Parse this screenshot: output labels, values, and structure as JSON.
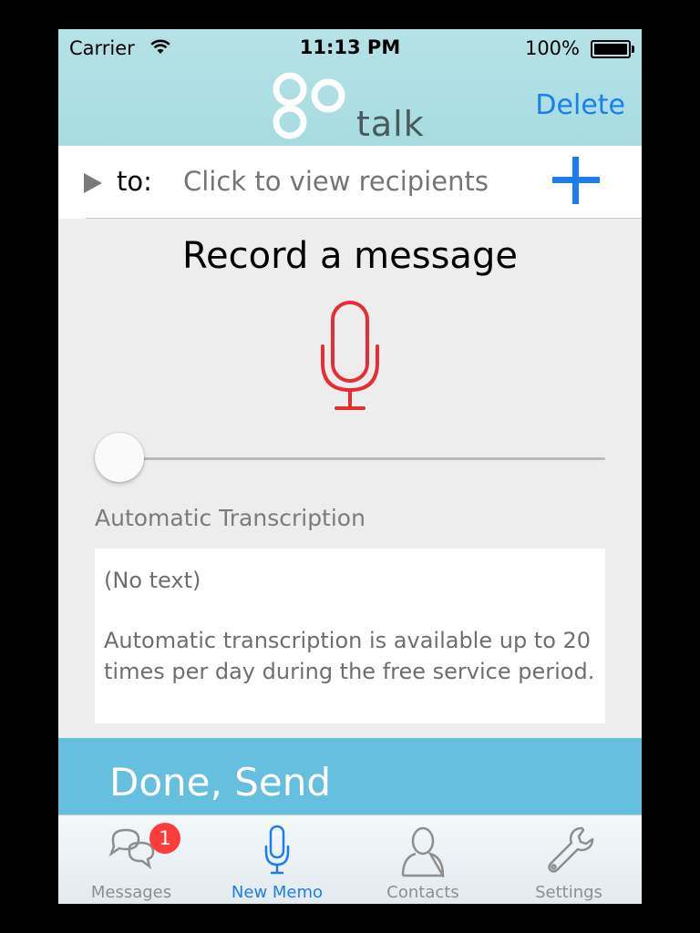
{
  "status_bar": {
    "carrier": "Carrier",
    "time": "11:13 PM",
    "battery": "100%"
  },
  "header": {
    "logo_text": "talk",
    "delete_label": "Delete"
  },
  "recipients": {
    "to_label": "to:",
    "placeholder": "Click to view recipients"
  },
  "recorder": {
    "title": "Record a message",
    "progress": 0
  },
  "transcription": {
    "label": "Automatic Transcription",
    "text_status": "(No text)",
    "info": "Automatic transcription is available up to 20 times per day during the free service period."
  },
  "done_button": {
    "label": "Done, Send"
  },
  "tabs": [
    {
      "label": "Messages",
      "icon": "chat-bubbles-icon",
      "badge": "1"
    },
    {
      "label": "New Memo",
      "icon": "microphone-icon",
      "active": true
    },
    {
      "label": "Contacts",
      "icon": "person-icon"
    },
    {
      "label": "Settings",
      "icon": "wrench-icon"
    }
  ],
  "colors": {
    "header_bg": "#a7dce1",
    "accent_blue": "#1a7ef0",
    "mic_red": "#e62d35",
    "done_bg": "#67bfe0",
    "badge_red": "#fc3d39"
  }
}
